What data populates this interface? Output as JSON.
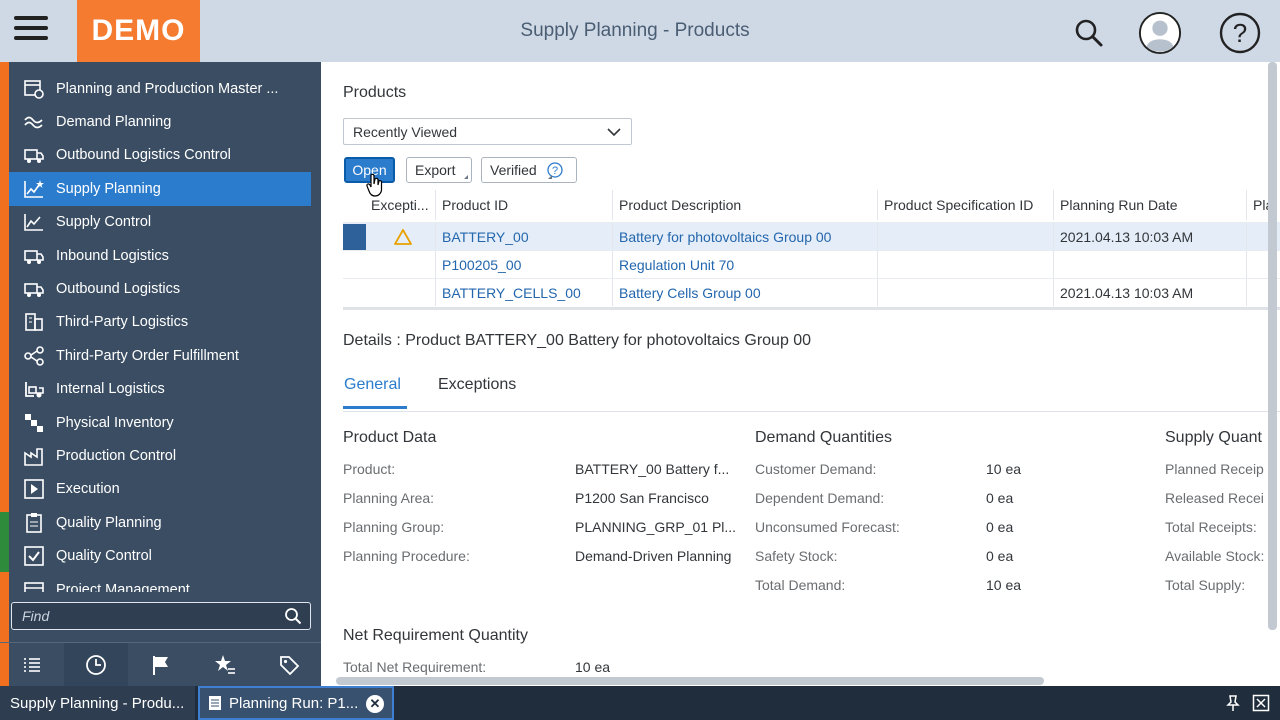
{
  "header": {
    "logo_text": "DEMO",
    "title": "Supply Planning - Products"
  },
  "sidebar": {
    "items": [
      {
        "label": "Planning and Production Master ...",
        "icon": "calendar-gear-icon"
      },
      {
        "label": "Demand Planning",
        "icon": "wave-icon"
      },
      {
        "label": "Outbound Logistics Control",
        "icon": "truck-icon"
      },
      {
        "label": "Supply Planning",
        "icon": "chart-star-icon",
        "active": true
      },
      {
        "label": "Supply Control",
        "icon": "chart-line-icon"
      },
      {
        "label": "Inbound Logistics",
        "icon": "truck-icon"
      },
      {
        "label": "Outbound Logistics",
        "icon": "truck-icon"
      },
      {
        "label": "Third-Party Logistics",
        "icon": "building-icon"
      },
      {
        "label": "Third-Party Order Fulfillment",
        "icon": "share-icon"
      },
      {
        "label": "Internal Logistics",
        "icon": "forklift-icon"
      },
      {
        "label": "Physical Inventory",
        "icon": "boxes-icon"
      },
      {
        "label": "Production Control",
        "icon": "factory-icon"
      },
      {
        "label": "Execution",
        "icon": "play-icon"
      },
      {
        "label": "Quality Planning",
        "icon": "clipboard-icon"
      },
      {
        "label": "Quality Control",
        "icon": "checkbox-icon"
      },
      {
        "label": "Project Management",
        "icon": "calendar-icon"
      }
    ],
    "find_placeholder": "Find",
    "tabs": [
      "list-icon",
      "clock-icon",
      "flag-icon",
      "star-list-icon",
      "tag-icon"
    ]
  },
  "main": {
    "products_title": "Products",
    "view_select": "Recently Viewed",
    "toolbar": {
      "open_label": "Open",
      "export_label": "Export",
      "verified_label": "Verified"
    },
    "table": {
      "headers": [
        "Excepti...",
        "Product ID",
        "Product Description",
        "Product Specification ID",
        "Planning Run Date",
        "Pla"
      ],
      "rows": [
        {
          "exception": "warning",
          "product_id": "BATTERY_00",
          "description": "Battery for photovoltaics Group 00",
          "spec_id": "",
          "run_date": "2021.04.13 10:03 AM",
          "selected": true
        },
        {
          "exception": "",
          "product_id": "P100205_00",
          "description": "Regulation Unit 70",
          "spec_id": "",
          "run_date": ""
        },
        {
          "exception": "",
          "product_id": "BATTERY_CELLS_00",
          "description": "Battery Cells Group 00",
          "spec_id": "",
          "run_date": "2021.04.13 10:03 AM"
        }
      ]
    },
    "details_title": "Details : Product BATTERY_00 Battery for photovoltaics Group 00",
    "tabs": {
      "general": "General",
      "exceptions": "Exceptions"
    },
    "product_data": {
      "title": "Product Data",
      "rows": [
        {
          "label": "Product:",
          "value": "BATTERY_00 Battery f..."
        },
        {
          "label": "Planning Area:",
          "value": "P1200 San Francisco"
        },
        {
          "label": "Planning Group:",
          "value": "PLANNING_GRP_01 Pl..."
        },
        {
          "label": "Planning Procedure:",
          "value": "Demand-Driven Planning"
        }
      ]
    },
    "demand_quantities": {
      "title": "Demand Quantities",
      "rows": [
        {
          "label": "Customer Demand:",
          "value": "10 ea"
        },
        {
          "label": "Dependent Demand:",
          "value": "0 ea"
        },
        {
          "label": "Unconsumed Forecast:",
          "value": "0 ea"
        },
        {
          "label": "Safety Stock:",
          "value": "0 ea"
        },
        {
          "label": "Total Demand:",
          "value": "10 ea"
        }
      ]
    },
    "supply_quantities": {
      "title": "Supply Quant",
      "rows": [
        {
          "label": "Planned Receip"
        },
        {
          "label": "Released Recei"
        },
        {
          "label": "Total Receipts:"
        },
        {
          "label": "Available Stock:"
        },
        {
          "label": "Total Supply:"
        }
      ]
    },
    "net_requirement": {
      "title": "Net Requirement Quantity",
      "label": "Total Net Requirement:",
      "value": "10 ea"
    }
  },
  "taskbar": {
    "tasks": [
      {
        "label": "Supply Planning - Produ..."
      },
      {
        "label": "Planning Run: P1..."
      }
    ],
    "close_symbol": "✕"
  },
  "colors": {
    "header_bg": "#cfd9e6",
    "logo_bg": "#f47b30",
    "sidebar_bg": "#3a4d62",
    "active_bg": "#2b7ccd",
    "link": "#2366ad",
    "warning": "#e9a100"
  }
}
